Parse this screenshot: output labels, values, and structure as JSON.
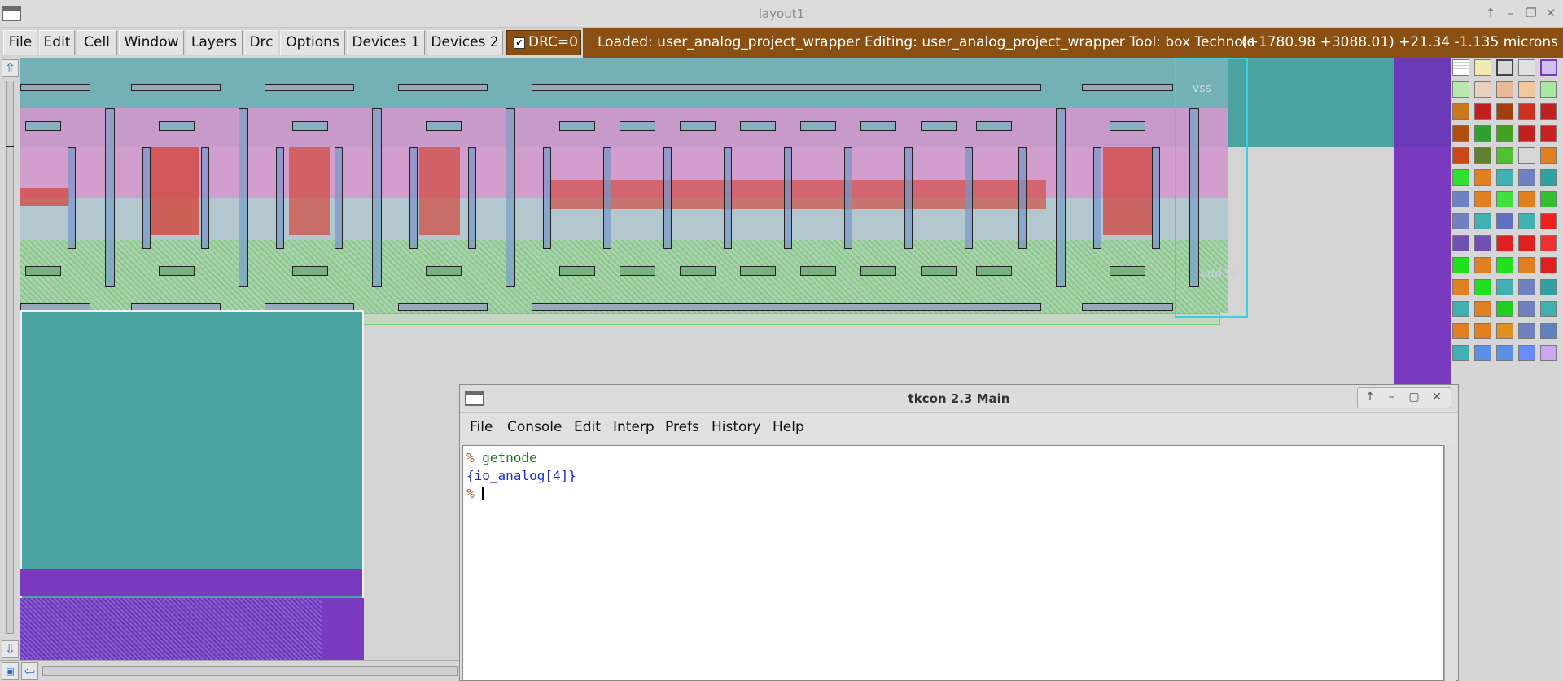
{
  "window": {
    "title": "layout1",
    "controls": [
      "↑",
      "–",
      "❐",
      "✕"
    ]
  },
  "menubar": {
    "items": [
      "File",
      "Edit",
      "Cell",
      "Window",
      "Layers",
      "Drc",
      "Options",
      "Devices 1",
      "Devices 2"
    ],
    "drc_label": "DRC=0",
    "status": {
      "loaded": "Loaded: user_analog_project_wrapper Editing: user_analog_project_wrapper Tool: box  Technolog",
      "coords": "(+1780.98 +3088.01) +21.34 -1.135 microns"
    }
  },
  "canvas": {
    "labels": {
      "vss": "vss",
      "vdd": "vdd3v3"
    }
  },
  "tkcon": {
    "title": "tkcon 2.3 Main",
    "controls": [
      "↑",
      "–",
      "▢",
      "✕"
    ],
    "menu": [
      "File",
      "Console",
      "Edit",
      "Interp",
      "Prefs",
      "History",
      "Help"
    ],
    "lines": [
      {
        "prompt": "% ",
        "text": "getnode",
        "kind": "cmd"
      },
      {
        "prompt": "",
        "text": "{io_analog[4]}",
        "kind": "out"
      },
      {
        "prompt": "% ",
        "text": "",
        "kind": "cursor"
      }
    ]
  },
  "colors": {
    "status_bg": "#8a4f12",
    "teal": "#4aa3a0",
    "purple": "#7a3ac0",
    "pink": "#d49ad4",
    "red": "#d04a3a",
    "green": "#4db04d"
  },
  "icons": {
    "scroll_up": "arrow-up-icon",
    "scroll_down": "arrow-down-icon",
    "scroll_left": "arrow-left-icon",
    "zoom_box": "zoom-box-icon",
    "checkbox": "check-icon"
  }
}
